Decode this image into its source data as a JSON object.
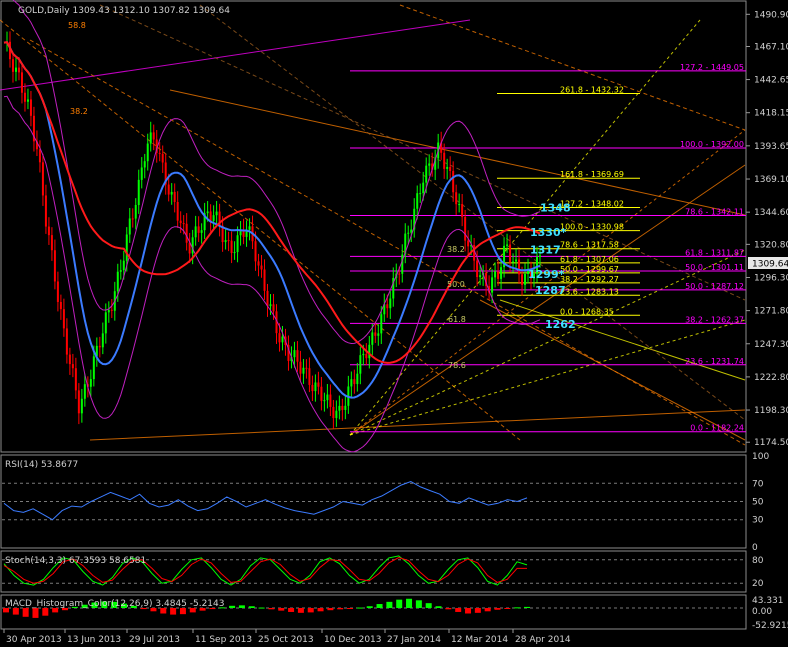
{
  "symbol_title": "GOLD,Daily  1309.43 1312.10 1307.82 1309.64",
  "colors": {
    "background": "#000000",
    "axis": "#9a9a9a",
    "bull_candle": "#00ff00",
    "bear_candle": "#ff0000",
    "ma_fast": "#3b7bff",
    "ma_slow": "#ff1a1a",
    "bands": "#c020c0",
    "fib_magenta": "#ff00ff",
    "fib_yellow": "#ffff00",
    "trend_orange": "#ff7f00",
    "label_cyan": "#40e0ff",
    "rsi": "#3b7bff",
    "stoch_main": "#00ff00",
    "stoch_signal": "#ff0000",
    "macd_pos": "#00ff00",
    "macd_neg": "#ff0000"
  },
  "chart_data": [
    {
      "type": "candlestick",
      "panel": "price",
      "title": "GOLD,Daily  1309.43 1312.10 1307.82 1309.64",
      "ylim": [
        1168,
        1500
      ],
      "y_ticks": [
        "1490.90",
        "1467.10",
        "1442.65",
        "1418.15",
        "1393.65",
        "1369.10",
        "1344.60",
        "1320.80",
        "1296.30",
        "1271.80",
        "1247.30",
        "1222.80",
        "1198.30",
        "1174.50"
      ],
      "last_price": "1309.64",
      "x_labels": [
        "30 Apr 2013",
        "13 Jun 2013",
        "29 Jul 2013",
        "11 Sep 2013",
        "25 Oct 2013",
        "10 Dec 2013",
        "27 Jan 2014",
        "12 Mar 2014",
        "28 Apr 2014"
      ],
      "close_path": [
        1470,
        1455,
        1440,
        1420,
        1390,
        1340,
        1300,
        1260,
        1230,
        1200,
        1218,
        1240,
        1262,
        1280,
        1305,
        1335,
        1360,
        1395,
        1400,
        1375,
        1355,
        1340,
        1318,
        1330,
        1340,
        1345,
        1330,
        1315,
        1325,
        1335,
        1315,
        1290,
        1270,
        1250,
        1240,
        1235,
        1225,
        1215,
        1210,
        1200,
        1195,
        1210,
        1225,
        1240,
        1250,
        1265,
        1282,
        1300,
        1325,
        1345,
        1370,
        1380,
        1392,
        1375,
        1355,
        1330,
        1310,
        1295,
        1290,
        1300,
        1320,
        1305,
        1295,
        1300,
        1310
      ],
      "fib_levels_magenta": [
        {
          "label": "127.2 - 1449.05",
          "value": 1449.05
        },
        {
          "label": "100.0 - 1392.00",
          "value": 1392.0
        },
        {
          "label": "78.6 - 1342.11",
          "value": 1342.11
        },
        {
          "label": "61.8 - 1311.87",
          "value": 1311.87
        },
        {
          "label": "50.0 - 1301.11",
          "value": 1301.11
        },
        {
          "label": "50.0 - 1287.12",
          "value": 1287.12
        },
        {
          "label": "38.2 - 1262.37",
          "value": 1262.37
        },
        {
          "label": "23.6 - 1231.74",
          "value": 1231.74
        },
        {
          "label": "0.0 - 1182.24",
          "value": 1182.24
        }
      ],
      "fib_levels_yellow": [
        {
          "label": "261.8 - 1432.32",
          "value": 1432.32
        },
        {
          "label": "161.8 - 1369.69",
          "value": 1369.69
        },
        {
          "label": "127.2 - 1348.02",
          "value": 1348.02
        },
        {
          "label": "100.0 - 1330.98",
          "value": 1330.98
        },
        {
          "label": "78.6 - 1317.58",
          "value": 1317.58
        },
        {
          "label": "61.8 - 1307.06",
          "value": 1307.06
        },
        {
          "label": "50.0 - 1299.67",
          "value": 1299.67
        },
        {
          "label": "38.2 - 1292.27",
          "value": 1292.27
        },
        {
          "label": "23.6 - 1283.13",
          "value": 1283.13
        },
        {
          "label": "0.0 - 1268.35",
          "value": 1268.35
        }
      ],
      "cyan_labels": [
        {
          "text": "1348",
          "value": 1348
        },
        {
          "text": "1330*",
          "value": 1330
        },
        {
          "text": "1317",
          "value": 1317
        },
        {
          "text": "1299*",
          "value": 1299
        },
        {
          "text": "1287",
          "value": 1287
        },
        {
          "text": "1262",
          "value": 1262
        }
      ],
      "small_fib_labels": [
        {
          "text": "58.8",
          "color": "#ff7f00"
        },
        {
          "text": "38.2",
          "color": "#ff7f00"
        },
        {
          "text": "38.2",
          "color": "#c8c864"
        },
        {
          "text": "50.0",
          "color": "#c8c864"
        },
        {
          "text": "61.8",
          "color": "#c8c864"
        },
        {
          "text": "78.6",
          "color": "#c8c864"
        }
      ]
    },
    {
      "type": "line",
      "panel": "rsi",
      "title": "RSI(14) 53.8677",
      "ylim": [
        0,
        100
      ],
      "y_ticks": [
        "100",
        "70",
        "50",
        "30",
        "0"
      ],
      "values": [
        48,
        40,
        38,
        42,
        36,
        30,
        40,
        45,
        44,
        50,
        55,
        60,
        56,
        52,
        58,
        48,
        44,
        46,
        52,
        45,
        40,
        42,
        48,
        55,
        50,
        44,
        48,
        52,
        47,
        43,
        40,
        38,
        36,
        40,
        44,
        50,
        48,
        46,
        52,
        56,
        62,
        68,
        72,
        66,
        62,
        58,
        50,
        48,
        54,
        50,
        46,
        48,
        52,
        50,
        54
      ]
    },
    {
      "type": "line",
      "panel": "stochastic",
      "title": "Stoch(14,3,3) 67.3593 58.6581",
      "ylim": [
        0,
        100
      ],
      "y_ticks": [
        "80",
        "20"
      ],
      "series": [
        {
          "name": "main",
          "values": [
            70,
            40,
            20,
            15,
            30,
            60,
            85,
            80,
            50,
            25,
            15,
            35,
            70,
            85,
            75,
            45,
            20,
            25,
            55,
            80,
            85,
            60,
            30,
            15,
            30,
            65,
            85,
            80,
            55,
            30,
            20,
            40,
            75,
            85,
            70,
            40,
            20,
            30,
            60,
            85,
            90,
            70,
            40,
            20,
            25,
            55,
            80,
            85,
            60,
            25,
            15,
            40,
            75,
            67
          ]
        },
        {
          "name": "signal",
          "values": [
            65,
            50,
            30,
            20,
            25,
            45,
            75,
            82,
            65,
            40,
            22,
            28,
            55,
            78,
            80,
            58,
            32,
            24,
            40,
            68,
            82,
            72,
            45,
            22,
            25,
            50,
            75,
            82,
            68,
            42,
            25,
            32,
            60,
            80,
            78,
            55,
            30,
            26,
            45,
            72,
            86,
            78,
            52,
            30,
            24,
            40,
            68,
            82,
            72,
            40,
            22,
            30,
            58,
            58
          ]
        }
      ]
    },
    {
      "type": "bar",
      "panel": "macd",
      "title": "MACD_Histogram_Color(12,26,9) 3.4845 -5.2143",
      "y_ticks": [
        "43.331",
        "0.00",
        "-52.9215"
      ],
      "values": [
        -20,
        -30,
        -40,
        -45,
        -35,
        -20,
        -10,
        5,
        15,
        25,
        30,
        28,
        20,
        10,
        -5,
        -15,
        -25,
        -30,
        -28,
        -20,
        -12,
        -5,
        3,
        10,
        12,
        8,
        2,
        -6,
        -12,
        -18,
        -22,
        -20,
        -15,
        -10,
        -6,
        -3,
        2,
        8,
        18,
        28,
        38,
        42,
        35,
        22,
        8,
        -6,
        -18,
        -25,
        -22,
        -15,
        -8,
        -2,
        3,
        5
      ]
    }
  ]
}
